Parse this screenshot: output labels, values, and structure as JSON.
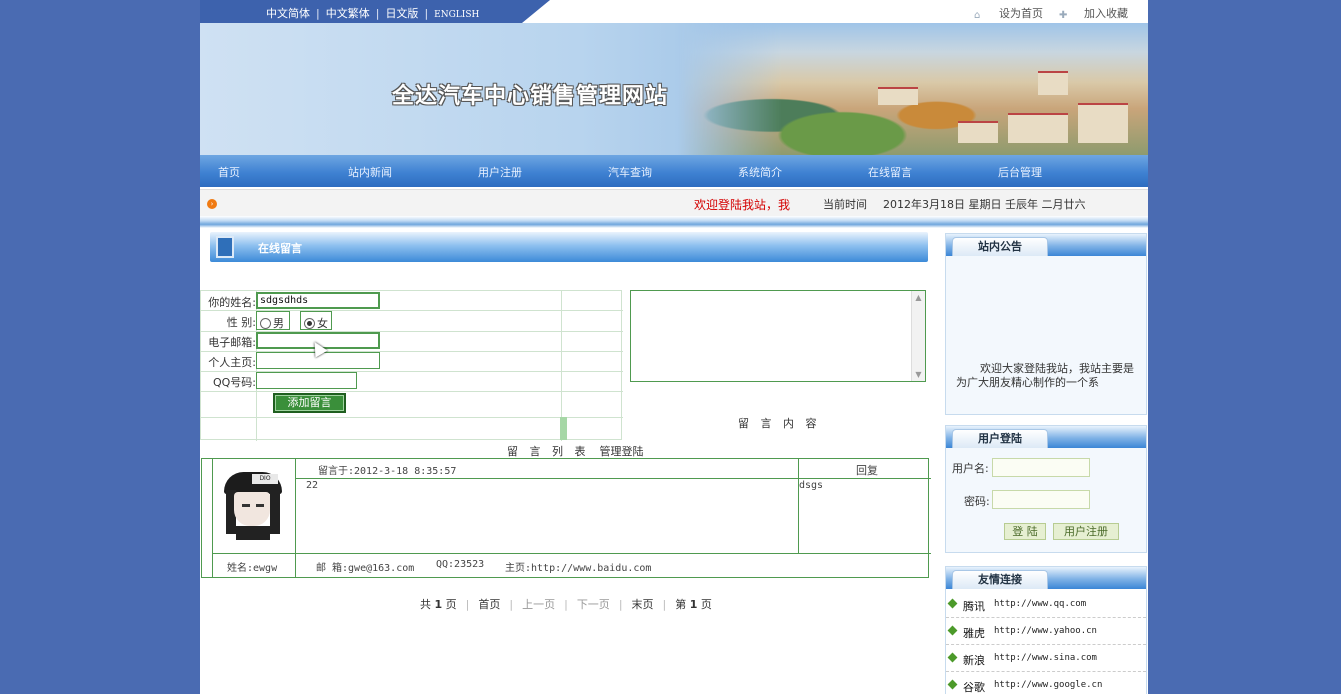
{
  "top": {
    "lang_links": [
      "中文简体",
      "中文繁体",
      "日文版",
      "ENGLISH"
    ],
    "set_home": "设为首页",
    "add_favorite": "加入收藏"
  },
  "banner": {
    "title": "全达汽车中心销售管理网站"
  },
  "nav": [
    "首页",
    "站内新闻",
    "用户注册",
    "汽车查询",
    "系统简介",
    "在线留言",
    "后台管理"
  ],
  "status": {
    "welcome": "欢迎登陆我站，我",
    "time_label": "当前时间",
    "date": "2012年3月18日 星期日 壬辰年 二月廿六"
  },
  "panel": {
    "title": "在线留言"
  },
  "form": {
    "name_label": "你的姓名:",
    "name_value": "sdgsdhds",
    "gender_label": "性 别:",
    "gender_options": [
      "男",
      "女"
    ],
    "gender_selected": "女",
    "email_label": "电子邮箱:",
    "email_value": "",
    "homepage_label": "个人主页:",
    "homepage_value": "",
    "qq_label": "QQ号码:",
    "qq_value": "",
    "submit_label": "添加留言",
    "content_label": "留 言 内 容"
  },
  "list": {
    "caption": "留 言 列 表",
    "manage_link": "管理登陆",
    "reply_header": "回复",
    "messages": [
      {
        "avatar_badge": "DIO",
        "posted": "留言于:2012-3-18 8:35:57",
        "content": "22",
        "reply": "dsgs",
        "name": "姓名:ewgw",
        "email": "邮 箱:gwe@163.com",
        "qq": "QQ:23523",
        "homepage": "主页:http://www.baidu.com"
      }
    ]
  },
  "pager": {
    "total_prefix": "共",
    "total_pages": "1",
    "total_suffix": "页",
    "first": "首页",
    "prev": "上一页",
    "next": "下一页",
    "last": "末页",
    "current_prefix": "第",
    "current_page": "1",
    "current_suffix": "页"
  },
  "sidebar": {
    "notice_title": "站内公告",
    "notice_text": "欢迎大家登陆我站，我站主要是为广大朋友精心制作的一个系",
    "login_title": "用户登陆",
    "username_label": "用户名:",
    "password_label": "密码:",
    "login_button": "登 陆",
    "register_button": "用户注册",
    "links_title": "友情连接",
    "links": [
      {
        "name": "腾讯",
        "url": "http://www.qq.com"
      },
      {
        "name": "雅虎",
        "url": "http://www.yahoo.cn"
      },
      {
        "name": "新浪",
        "url": "http://www.sina.com"
      },
      {
        "name": "谷歌",
        "url": "http://www.google.cn"
      }
    ]
  }
}
